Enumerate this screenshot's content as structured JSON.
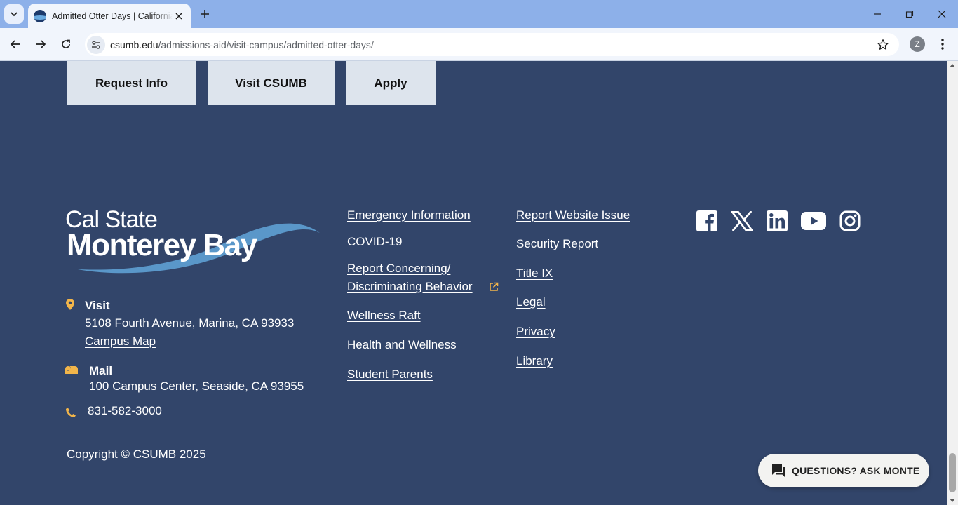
{
  "browser": {
    "tab_title": "Admitted Otter Days | California State University Monterey Bay",
    "url_host": "csumb.edu",
    "url_path": "/admissions-aid/visit-campus/admitted-otter-days/",
    "profile_initial": "Z"
  },
  "cta": {
    "request_info": "Request Info",
    "visit": "Visit CSUMB",
    "apply": "Apply"
  },
  "logo": {
    "line1": "Cal State",
    "line2": "Monterey Bay"
  },
  "contact": {
    "visit_heading": "Visit",
    "visit_address": "5108 Fourth Avenue, Marina, CA 93933",
    "campus_map": "Campus Map",
    "mail_heading": "Mail",
    "mail_address": "100 Campus Center, Seaside, CA 93955",
    "phone": "831-582-3000"
  },
  "links_col1": {
    "emergency": "Emergency Information",
    "covid": "COVID-19",
    "report_line1": "Report Concerning/",
    "report_line2": "Discriminating Behavior",
    "wellness_raft": "Wellness Raft",
    "health": "Health and Wellness",
    "student_parents": "Student Parents"
  },
  "links_col2": {
    "report_issue": "Report Website Issue",
    "security": "Security Report",
    "title_ix": "Title IX",
    "legal": "Legal",
    "privacy": "Privacy",
    "library": "Library"
  },
  "social_icons": [
    "facebook-icon",
    "x-twitter-icon",
    "linkedin-icon",
    "youtube-icon",
    "instagram-icon"
  ],
  "copyright": "Copyright © CSUMB 2025",
  "chat": {
    "label": "QUESTIONS? ASK MONTE"
  },
  "colors": {
    "footer_bg": "#32456a",
    "button_bg": "#dde4ed",
    "accent_gold": "#f2b54a",
    "wave_blue": "#5a97c9"
  }
}
